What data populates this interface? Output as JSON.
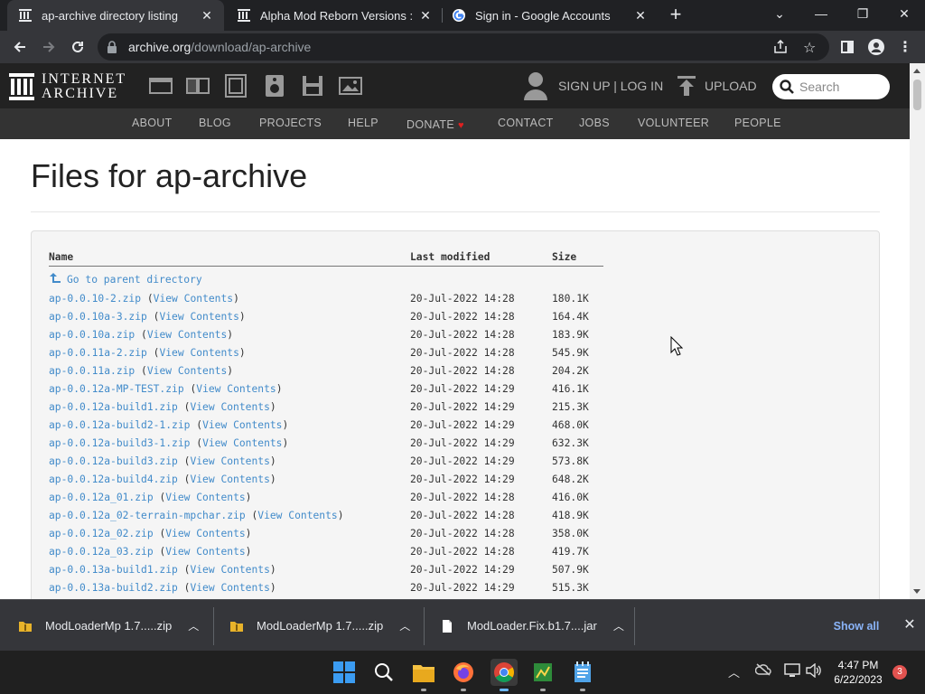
{
  "tabs": [
    {
      "title": "ap-archive directory listing",
      "active": true
    },
    {
      "title": "Alpha Mod Reborn Versions : Mr",
      "active": false
    },
    {
      "title": "Sign in - Google Accounts",
      "active": false
    }
  ],
  "toolbar": {
    "url_host": "archive.org",
    "url_path": "/download/ap-archive"
  },
  "ia_header": {
    "logo_line1": "INTERNET",
    "logo_line2": "ARCHIVE",
    "signup": "SIGN UP | LOG IN",
    "upload": "UPLOAD",
    "search_placeholder": "Search",
    "nav": [
      "ABOUT",
      "BLOG",
      "PROJECTS",
      "HELP",
      "DONATE",
      "CONTACT",
      "JOBS",
      "VOLUNTEER",
      "PEOPLE"
    ]
  },
  "page": {
    "title": "Files for ap-archive",
    "columns": {
      "name": "Name",
      "modified": "Last modified",
      "size": "Size"
    },
    "parent_link": "Go to parent directory",
    "view_contents": "View Contents",
    "files": [
      {
        "name": "ap-0.0.10-2.zip",
        "modified": "20-Jul-2022 14:28",
        "size": "180.1K"
      },
      {
        "name": "ap-0.0.10a-3.zip",
        "modified": "20-Jul-2022 14:28",
        "size": "164.4K"
      },
      {
        "name": "ap-0.0.10a.zip",
        "modified": "20-Jul-2022 14:28",
        "size": "183.9K"
      },
      {
        "name": "ap-0.0.11a-2.zip",
        "modified": "20-Jul-2022 14:28",
        "size": "545.9K"
      },
      {
        "name": "ap-0.0.11a.zip",
        "modified": "20-Jul-2022 14:28",
        "size": "204.2K"
      },
      {
        "name": "ap-0.0.12a-MP-TEST.zip",
        "modified": "20-Jul-2022 14:29",
        "size": "416.1K"
      },
      {
        "name": "ap-0.0.12a-build1.zip",
        "modified": "20-Jul-2022 14:29",
        "size": "215.3K"
      },
      {
        "name": "ap-0.0.12a-build2-1.zip",
        "modified": "20-Jul-2022 14:29",
        "size": "468.0K"
      },
      {
        "name": "ap-0.0.12a-build3-1.zip",
        "modified": "20-Jul-2022 14:29",
        "size": "632.3K"
      },
      {
        "name": "ap-0.0.12a-build3.zip",
        "modified": "20-Jul-2022 14:29",
        "size": "573.8K"
      },
      {
        "name": "ap-0.0.12a-build4.zip",
        "modified": "20-Jul-2022 14:29",
        "size": "648.2K"
      },
      {
        "name": "ap-0.0.12a_01.zip",
        "modified": "20-Jul-2022 14:28",
        "size": "416.0K"
      },
      {
        "name": "ap-0.0.12a_02-terrain-mpchar.zip",
        "modified": "20-Jul-2022 14:28",
        "size": "418.9K"
      },
      {
        "name": "ap-0.0.12a_02.zip",
        "modified": "20-Jul-2022 14:28",
        "size": "358.0K"
      },
      {
        "name": "ap-0.0.12a_03.zip",
        "modified": "20-Jul-2022 14:28",
        "size": "419.7K"
      },
      {
        "name": "ap-0.0.13a-build1.zip",
        "modified": "20-Jul-2022 14:29",
        "size": "507.9K"
      },
      {
        "name": "ap-0.0.13a-build2.zip",
        "modified": "20-Jul-2022 14:29",
        "size": "515.3K"
      }
    ]
  },
  "downloads": {
    "items": [
      {
        "name": "ModLoaderMp 1.7.....zip",
        "type": "zip"
      },
      {
        "name": "ModLoaderMp 1.7.....zip",
        "type": "zip"
      },
      {
        "name": "ModLoader.Fix.b1.7....jar",
        "type": "jar"
      }
    ],
    "show_all": "Show all"
  },
  "taskbar": {
    "time": "4:47 PM",
    "date": "6/22/2023",
    "notifications": "3"
  },
  "colors": {
    "link": "#428bca",
    "chrome_dark": "#202124",
    "chrome_toolbar": "#35363a",
    "ia_header": "#222222",
    "ia_nav": "#333333",
    "show_all": "#8ab4f8"
  }
}
